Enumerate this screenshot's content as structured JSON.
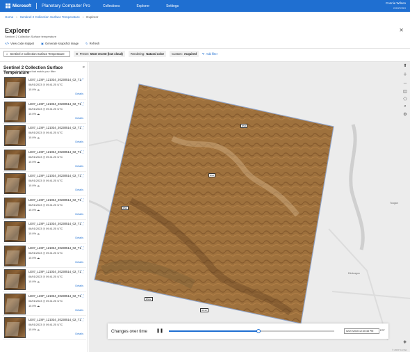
{
  "header": {
    "brand": "Microsoft",
    "app": "Planetary Computer Pro",
    "nav": [
      "Collections",
      "Explorer",
      "Settings"
    ],
    "user_name": "Connie Wilson",
    "user_org": "CONTOSO"
  },
  "breadcrumb": [
    "Home",
    "Sentinel 2 Collection Surface Temperature",
    "Explorer"
  ],
  "page": {
    "title": "Explorer",
    "subtitle": "Sentinel 2 Collection Surface temperature"
  },
  "actions": {
    "code": "View code snippet",
    "snapshot": "Generate snapshot image",
    "refresh": "Refresh"
  },
  "filters": {
    "collection": "Sentinel 2 Collection Surface Temperature",
    "preset_label": "Preset:",
    "preset_value": "Most recent (low cloud)",
    "rendering_label": "Rendering:",
    "rendering_value": "Natural color",
    "custom_label": "Custom:",
    "custom_value": "Acquired",
    "add": "Add filter"
  },
  "panel": {
    "title": "Sentinel 2 Collection Surface Temperature",
    "subtitle": "Showing 10 of 10 items that match your filter",
    "items": [
      {
        "id": "LE07_L2SP_121034_20230514_02_T1",
        "date": "06/01/2023",
        "time": "09:41:25",
        "tz": "UTC",
        "cloud": "10.0%",
        "details": "Details"
      },
      {
        "id": "LE07_L2SP_121034_20230514_02_T1",
        "date": "06/01/2023",
        "time": "09:41:25",
        "tz": "UTC",
        "cloud": "10.0%",
        "details": "Details"
      },
      {
        "id": "LE07_L2SP_121034_20230514_02_T1",
        "date": "06/01/2023",
        "time": "09:41:25",
        "tz": "UTC",
        "cloud": "10.0%",
        "details": "Details"
      },
      {
        "id": "LE07_L2SP_121034_20230514_02_T1",
        "date": "06/01/2023",
        "time": "09:41:25",
        "tz": "UTC",
        "cloud": "10.0%",
        "details": "Details"
      },
      {
        "id": "LE07_L2SP_121034_20230514_02_T1",
        "date": "06/01/2023",
        "time": "09:41:25",
        "tz": "UTC",
        "cloud": "10.0%",
        "details": "Details"
      },
      {
        "id": "LE07_L2SP_121034_20230514_02_T1",
        "date": "06/01/2023",
        "time": "09:41:25",
        "tz": "UTC",
        "cloud": "10.0%",
        "details": "Details"
      },
      {
        "id": "LE07_L2SP_121034_20230514_02_T1",
        "date": "06/01/2023",
        "time": "09:41:25",
        "tz": "UTC",
        "cloud": "10.0%",
        "details": "Details"
      },
      {
        "id": "LE07_L2SP_121034_20230514_02_T1",
        "date": "06/01/2023",
        "time": "09:41:25",
        "tz": "UTC",
        "cloud": "10.0%",
        "details": "Details"
      },
      {
        "id": "LE07_L2SP_121034_20230514_02_T1",
        "date": "06/01/2023",
        "time": "09:41:25",
        "tz": "UTC",
        "cloud": "10.0%",
        "details": "Details"
      },
      {
        "id": "LE07_L2SP_121034_20230514_02_T1",
        "date": "06/01/2023",
        "time": "09:41:25",
        "tz": "UTC",
        "cloud": "10.0%",
        "details": "Details"
      },
      {
        "id": "LE07_L2SP_121034_20230514_02_T1",
        "date": "06/01/2023",
        "time": "09:41:25",
        "tz": "UTC",
        "cloud": "10.0%",
        "details": "Details"
      }
    ]
  },
  "map": {
    "cities": [
      "Tougan",
      "Dédougou",
      "Nouna"
    ],
    "roads": [
      "RN4",
      "RN4",
      "RN4",
      "RN12",
      "RN13"
    ],
    "attribution": "© 2023 TomTom"
  },
  "timeline": {
    "label": "Changes over time",
    "progress": 0.54,
    "date": "02/27/2025   12:30:45 PM",
    "tz": "EST"
  },
  "colors": {
    "brand": "#1f6fd1",
    "footprint_outline": "#8aa6d6"
  }
}
